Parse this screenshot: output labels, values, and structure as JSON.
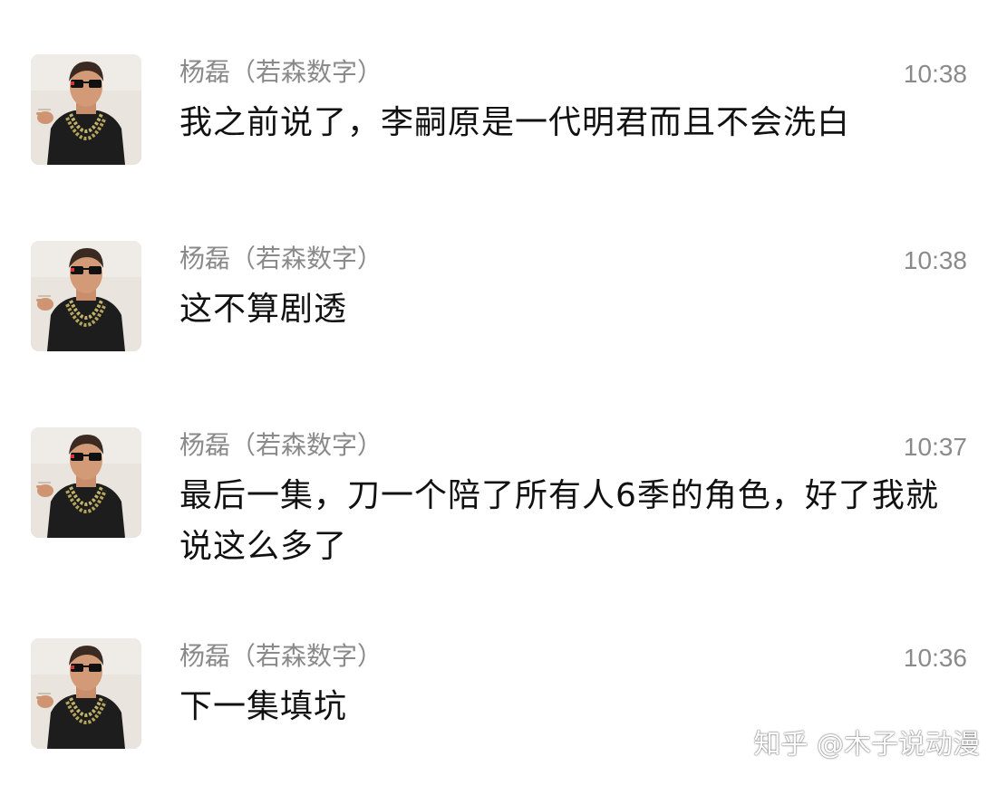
{
  "messages": [
    {
      "sender": "杨磊（若森数字）",
      "time": "10:38",
      "text": "我之前说了，李嗣原是一代明君而且不会洗白"
    },
    {
      "sender": "杨磊（若森数字）",
      "time": "10:38",
      "text": "这不算剧透"
    },
    {
      "sender": "杨磊（若森数字）",
      "time": "10:37",
      "text": "最后一集，刀一个陪了所有人6季的角色，好了我就说这么多了"
    },
    {
      "sender": "杨磊（若森数字）",
      "time": "10:36",
      "text": "下一集填坑"
    }
  ],
  "watermark": "知乎 @木子说动漫",
  "colors": {
    "meta_text": "#8a8a8a",
    "message_text": "#111111",
    "background": "#ffffff"
  }
}
